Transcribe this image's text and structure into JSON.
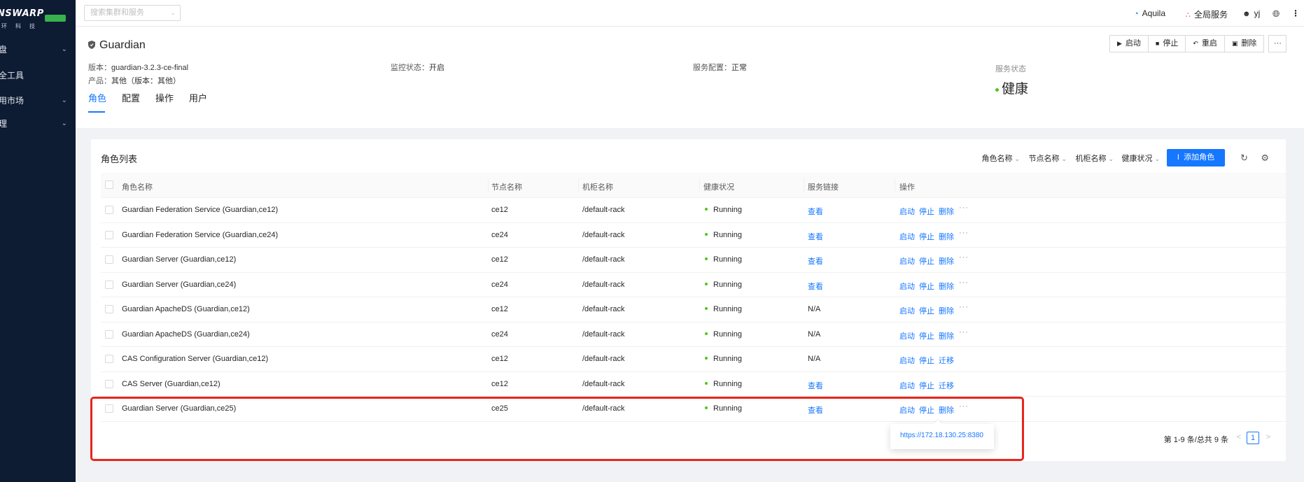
{
  "sidebar": {
    "logo_text": "NSWARP",
    "logo_sub": "环科技",
    "items": [
      {
        "label": "盘",
        "has_chevron": true
      },
      {
        "label": "全工具",
        "has_chevron": false
      },
      {
        "label": "用市场",
        "has_chevron": true
      },
      {
        "label": "理",
        "has_chevron": true
      }
    ]
  },
  "topbar": {
    "search_placeholder": "搜索集群和服务",
    "aquila": "Aquila",
    "global_services": "全局服务",
    "user": "yj"
  },
  "header": {
    "service_name": "Guardian",
    "version_label": "版本：",
    "version_value": "guardian-3.2.3-ce-final",
    "product_label": "产品：",
    "product_value": "其他（版本：其他）",
    "monitor_label": "监控状态：",
    "monitor_value": "开启",
    "config_label": "服务配置：",
    "config_value": "正常",
    "state_label": "服务状态",
    "state_value": "健康",
    "buttons": {
      "start": "启动",
      "stop": "停止",
      "restart": "重启",
      "delete": "删除",
      "more": "···"
    },
    "tabs": [
      "角色",
      "配置",
      "操作",
      "用户"
    ]
  },
  "roles": {
    "title": "角色列表",
    "filters": [
      "角色名称",
      "节点名称",
      "机柜名称",
      "健康状况"
    ],
    "add_button": "添加角色",
    "columns": [
      "角色名称",
      "节点名称",
      "机柜名称",
      "健康状况",
      "服务链接",
      "操作"
    ],
    "rows": [
      {
        "name": "Guardian Federation Service (Guardian,ce12)",
        "node": "ce12",
        "rack": "/default-rack",
        "health": "Running",
        "link": "查看",
        "link_is_url": true,
        "actions": [
          "启动",
          "停止",
          "删除"
        ],
        "more": true
      },
      {
        "name": "Guardian Federation Service (Guardian,ce24)",
        "node": "ce24",
        "rack": "/default-rack",
        "health": "Running",
        "link": "查看",
        "link_is_url": true,
        "actions": [
          "启动",
          "停止",
          "删除"
        ],
        "more": true
      },
      {
        "name": "Guardian Server (Guardian,ce12)",
        "node": "ce12",
        "rack": "/default-rack",
        "health": "Running",
        "link": "查看",
        "link_is_url": true,
        "actions": [
          "启动",
          "停止",
          "删除"
        ],
        "more": true
      },
      {
        "name": "Guardian Server (Guardian,ce24)",
        "node": "ce24",
        "rack": "/default-rack",
        "health": "Running",
        "link": "查看",
        "link_is_url": true,
        "actions": [
          "启动",
          "停止",
          "删除"
        ],
        "more": true
      },
      {
        "name": "Guardian ApacheDS (Guardian,ce12)",
        "node": "ce12",
        "rack": "/default-rack",
        "health": "Running",
        "link": "N/A",
        "link_is_url": false,
        "actions": [
          "启动",
          "停止",
          "删除"
        ],
        "more": true
      },
      {
        "name": "Guardian ApacheDS (Guardian,ce24)",
        "node": "ce24",
        "rack": "/default-rack",
        "health": "Running",
        "link": "N/A",
        "link_is_url": false,
        "actions": [
          "启动",
          "停止",
          "删除"
        ],
        "more": true
      },
      {
        "name": "CAS Configuration Server (Guardian,ce12)",
        "node": "ce12",
        "rack": "/default-rack",
        "health": "Running",
        "link": "N/A",
        "link_is_url": false,
        "actions": [
          "启动",
          "停止",
          "迁移"
        ],
        "more": false
      },
      {
        "name": "CAS Server (Guardian,ce12)",
        "node": "ce12",
        "rack": "/default-rack",
        "health": "Running",
        "link": "查看",
        "link_is_url": true,
        "actions": [
          "启动",
          "停止",
          "迁移"
        ],
        "more": false
      },
      {
        "name": "Guardian Server (Guardian,ce25)",
        "node": "ce25",
        "rack": "/default-rack",
        "health": "Running",
        "link": "查看",
        "link_is_url": true,
        "actions": [
          "启动",
          "停止",
          "删除"
        ],
        "more": true
      }
    ],
    "pagination": {
      "total_text": "第 1-9 条/总共 9 条",
      "current_page": "1"
    }
  },
  "popover": {
    "url": "https://172.18.130.25:8380"
  },
  "colors": {
    "primary": "#1677ff",
    "sidebar": "#0d1b33",
    "healthy": "#52c41a",
    "highlight": "#e8261c"
  }
}
